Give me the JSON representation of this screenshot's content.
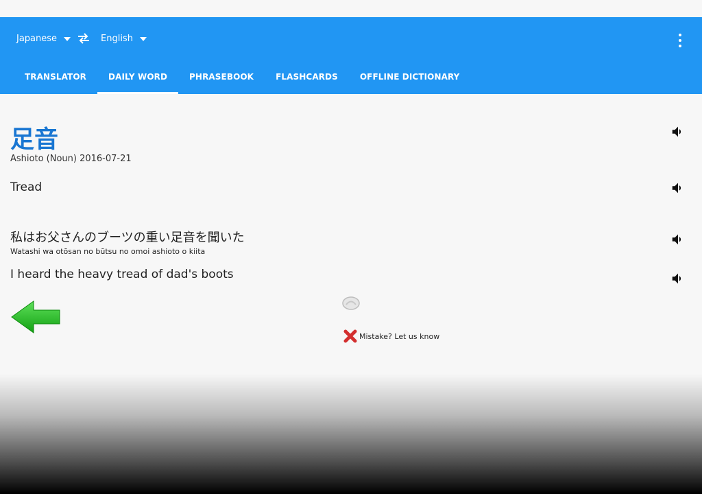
{
  "header": {
    "source_language": "Japanese",
    "target_language": "English",
    "tabs": [
      {
        "label": "TRANSLATOR",
        "active": false
      },
      {
        "label": "DAILY WORD",
        "active": true
      },
      {
        "label": "PHRASEBOOK",
        "active": false
      },
      {
        "label": "FLASHCARDS",
        "active": false
      },
      {
        "label": "OFFLINE DICTIONARY",
        "active": false
      }
    ]
  },
  "daily_word": {
    "word": "足音",
    "reading": "Ashioto (Noun) 2016-07-21",
    "translation": "Tread",
    "example_japanese": "私はお父さんのブーツの重い足音を聞いた",
    "example_romaji": "Watashi wa otōsan no būtsu no omoi ashioto o kiita",
    "example_english": "I heard the heavy tread of dad's boots"
  },
  "feedback": {
    "mistake_label": "Mistake? Let us know"
  },
  "icons": {
    "speaker": "speaker-icon",
    "back": "green-left-arrow-icon",
    "mistake": "red-x-icon",
    "swap": "swap-arrows-icon",
    "menu": "more-vert-icon"
  },
  "colors": {
    "appbar": "#2196f3",
    "word": "#1976d2"
  }
}
